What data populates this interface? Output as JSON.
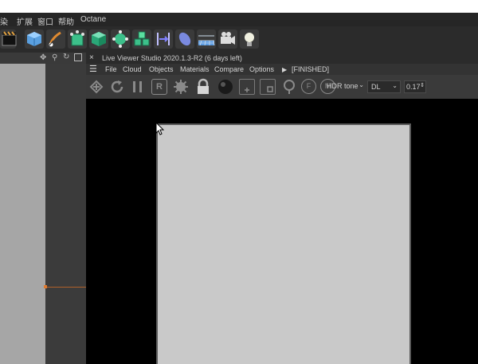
{
  "menubar": {
    "items": [
      "染",
      "扩展",
      "窗口",
      "帮助",
      "Octane"
    ]
  },
  "toolbar": {
    "icons": [
      "clapper-icon",
      "cube-icon",
      "pen-icon",
      "extrude-icon",
      "box-icon",
      "subdivide-icon",
      "array-icon",
      "deformer-icon",
      "capsule-icon",
      "floor-icon",
      "camera-icon",
      "light-icon"
    ]
  },
  "left_panel": {
    "icons": [
      "move-icon",
      "pin-icon",
      "refresh-icon",
      "maximize-icon"
    ]
  },
  "live_viewer": {
    "close_label": "×",
    "title": "Live Viewer Studio 2020.1.3-R2 (6 days left)",
    "menu": {
      "items": [
        "File",
        "Cloud",
        "Objects",
        "Materials",
        "Compare",
        "Options"
      ],
      "status": "[FINISHED]"
    },
    "tools": {
      "render_letter": "R",
      "f_letter": "F",
      "m_letter": "M",
      "tonemap": "HDR tone",
      "kernel": "DL",
      "value": "0.17"
    }
  },
  "colors": {
    "accent_orange": "#e07a2e",
    "render_gray": "#c9c9c9",
    "menu_bg": "#262626"
  }
}
